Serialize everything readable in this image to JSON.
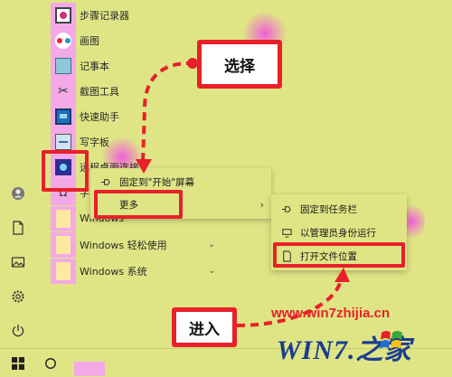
{
  "start_menu": {
    "apps": [
      {
        "label": "步骤记录器",
        "icon": "steps-recorder-icon"
      },
      {
        "label": "画图",
        "icon": "paint-icon"
      },
      {
        "label": "记事本",
        "icon": "notepad-icon"
      },
      {
        "label": "截图工具",
        "icon": "snipping-tool-icon"
      },
      {
        "label": "快速助手",
        "icon": "quick-assist-icon"
      },
      {
        "label": "写字板",
        "icon": "wordpad-icon"
      },
      {
        "label": "远程桌面连接",
        "icon": "remote-desktop-icon"
      },
      {
        "label": "字",
        "icon": "character-map-icon"
      }
    ],
    "folders": [
      {
        "label": "Windows"
      },
      {
        "label": "Windows 轻松使用"
      },
      {
        "label": "Windows 系统"
      }
    ],
    "chevron": "⌄"
  },
  "context_menu": {
    "pin_start": "固定到\"开始\"屏幕",
    "more": "更多",
    "more_arrow": "›"
  },
  "submenu": {
    "pin_taskbar": "固定到任务栏",
    "run_as_admin": "以管理员身份运行",
    "open_location": "打开文件位置"
  },
  "callouts": {
    "select": "选择",
    "enter": "进入"
  },
  "watermark": {
    "url": "www.win7zhijia.cn",
    "logo": "WIN7.之家"
  },
  "colors": {
    "background": "#dfe585",
    "tile": "#f3a9e6",
    "highlight": "#e8202a"
  }
}
